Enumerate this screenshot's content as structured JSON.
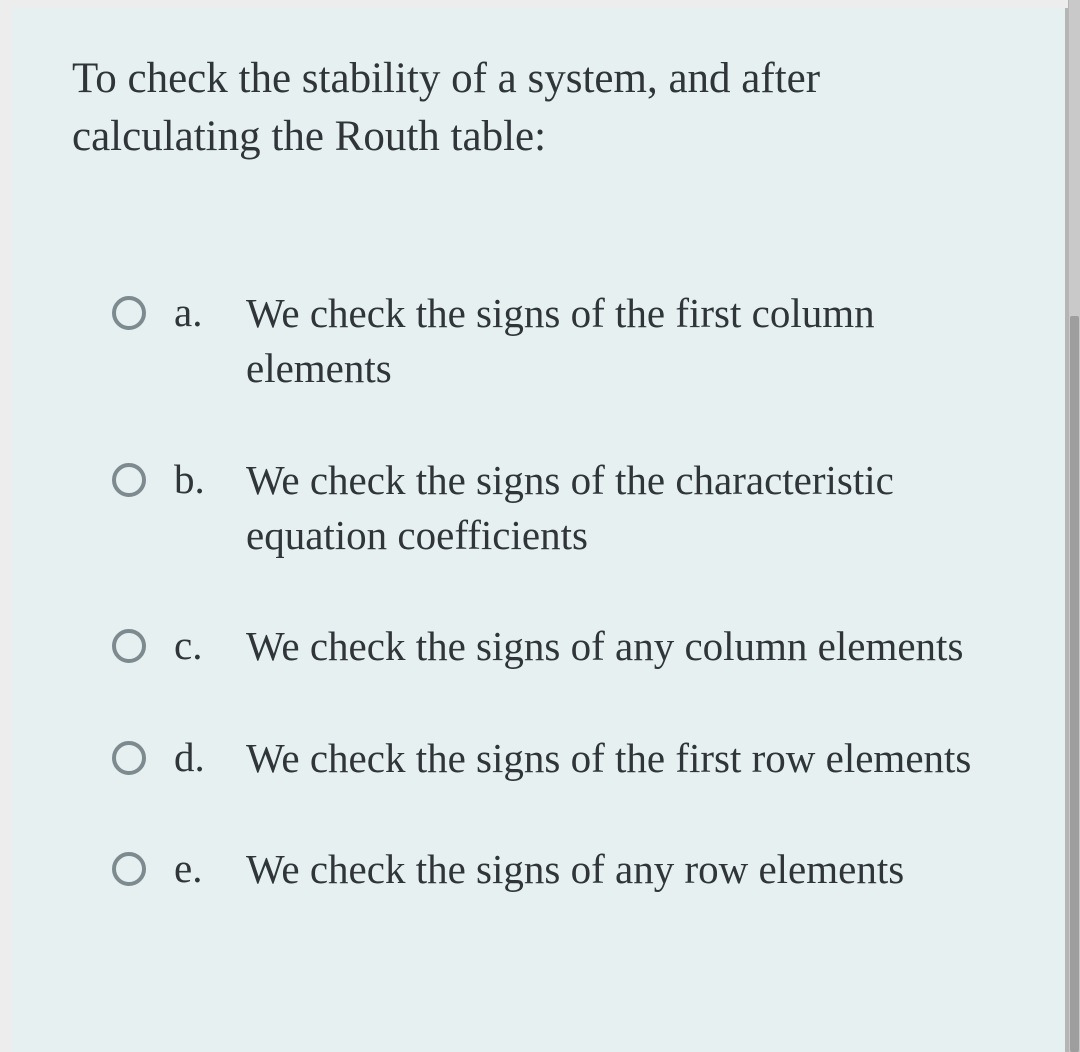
{
  "question": "To check the stability of a system, and after calculating the Routh table:",
  "options": [
    {
      "letter": "a.",
      "text": "We check the signs of the first column elements"
    },
    {
      "letter": "b.",
      "text": "We check the signs of the characteristic equation coefficients"
    },
    {
      "letter": "c.",
      "text": "We check the signs of any column elements"
    },
    {
      "letter": "d.",
      "text": "We check the signs of the first row elements"
    },
    {
      "letter": "e.",
      "text": "We check the signs of any row elements"
    }
  ]
}
